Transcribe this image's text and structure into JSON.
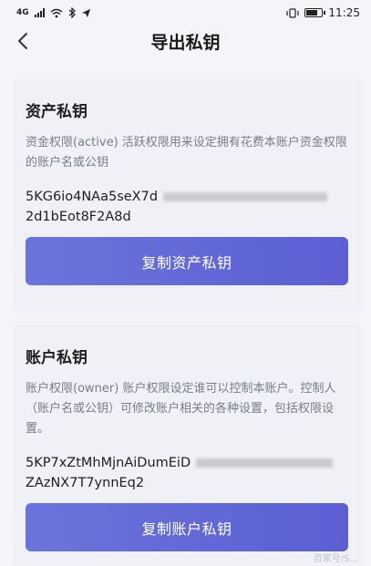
{
  "status": {
    "network": "4G",
    "time": "11:25",
    "battery": 0.75
  },
  "nav": {
    "title": "导出私钥"
  },
  "active": {
    "title": "资产私钥",
    "description": "资金权限(active) 活跃权限用来设定拥有花费本账户资金权限的账户名或公钥",
    "key_line1": "5KG6io4NAa5seX7d",
    "key_line2": "2d1bEot8F2A8d",
    "copy_label": "复制资产私钥"
  },
  "owner": {
    "title": "账户私钥",
    "description": "账户权限(owner) 账户权限设定谁可以控制本账户。控制人（账户名或公钥）可修改账户相关的各种设置，包括权限设置。",
    "key_line1": "5KP7xZtMhMjnAiDumEiD",
    "key_line2": "ZAzNX7T7ynnEq2",
    "copy_label": "复制账户私钥"
  },
  "watermark": "百家号/S..."
}
